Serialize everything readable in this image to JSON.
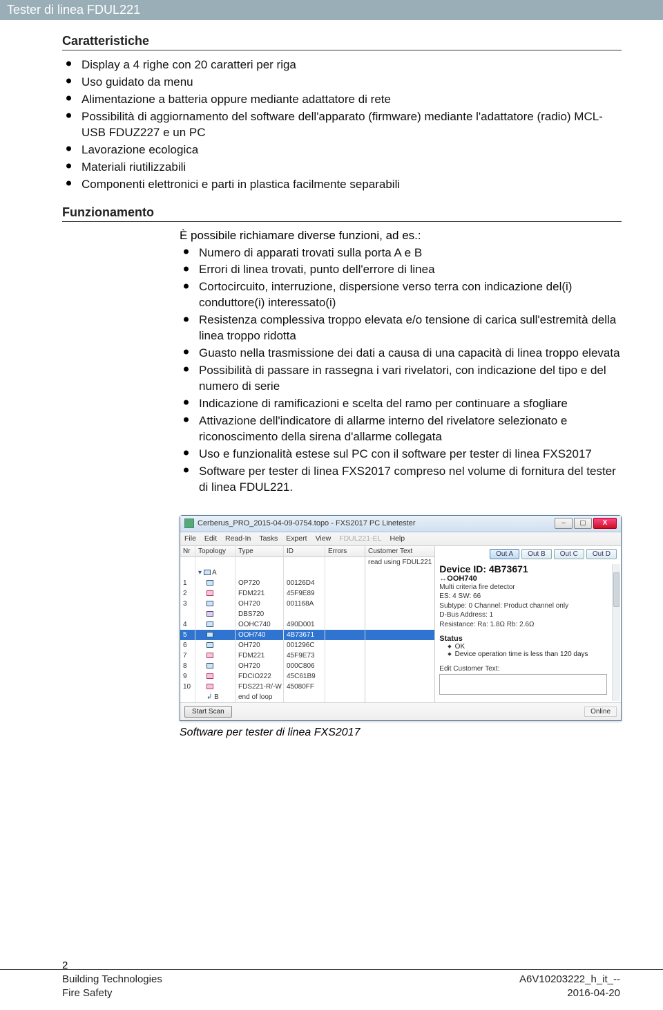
{
  "title_bar": "Tester di linea FDUL221",
  "sections": {
    "caratteristiche": {
      "heading": "Caratteristiche",
      "items": [
        "Display a 4 righe con 20 caratteri per riga",
        "Uso guidato da menu",
        "Alimentazione a batteria oppure mediante adattatore di rete",
        "Possibilità di aggiornamento del software dell'apparato (firmware) mediante l'adattatore (radio) MCL-USB FDUZ227 e un PC",
        "Lavorazione ecologica",
        "Materiali riutilizzabili",
        "Componenti elettronici e parti in plastica facilmente separabili"
      ]
    },
    "funzionamento": {
      "heading": "Funzionamento",
      "intro": "È possibile richiamare diverse funzioni, ad es.:",
      "items": [
        "Numero di apparati trovati sulla porta A e B",
        "Errori di linea trovati, punto dell'errore di linea",
        "Cortocircuito, interruzione, dispersione verso terra con indicazione del(i) conduttore(i) interessato(i)",
        "Resistenza complessiva troppo elevata e/o tensione di carica sull'estremità della linea troppo ridotta",
        "Guasto nella trasmissione dei dati a causa di una capacità di linea troppo elevata",
        "Possibilità di passare in rassegna i vari rivelatori, con indicazione del tipo e del numero di serie",
        "Indicazione di ramificazioni e scelta del ramo per continuare a sfogliare",
        "Attivazione dell'indicatore di allarme interno del rivelatore selezionato e riconoscimento della sirena d'allarme collegata",
        "Uso e funzionalità estese sul PC con il software per tester di linea FXS2017",
        "Software per tester di linea FXS2017 compreso nel volume di fornitura del tester di linea FDUL221."
      ]
    }
  },
  "screenshot": {
    "window_title": "Cerberus_PRO_2015-04-09-0754.topo - FXS2017 PC Linetester",
    "menus": [
      "File",
      "Edit",
      "Read-In",
      "Tasks",
      "Expert",
      "View",
      "FDUL221-EL",
      "Help"
    ],
    "menu_dim_index": 6,
    "columns": {
      "nr": "Nr",
      "topo": "Topology",
      "type": "Type",
      "id": "ID",
      "err": "Errors",
      "cust": "Customer Text"
    },
    "cust_header_note": "read using FDUL221",
    "rows": [
      {
        "nr": "",
        "topo_label": "▾ ▢ A",
        "type": "",
        "id": "",
        "sel": false,
        "style": "root"
      },
      {
        "nr": "1",
        "type": "OP720",
        "id": "00126D4",
        "sel": false,
        "style": "blue"
      },
      {
        "nr": "2",
        "type": "FDM221",
        "id": "45F9E89",
        "sel": false,
        "style": "pink"
      },
      {
        "nr": "3",
        "type": "OH720",
        "id": "001168A",
        "sel": false,
        "style": "blue"
      },
      {
        "nr": "",
        "type": "DBS720",
        "id": "",
        "sel": false,
        "style": "purple"
      },
      {
        "nr": "4",
        "type": "OOHC740",
        "id": "490D001",
        "sel": false,
        "style": "blue"
      },
      {
        "nr": "5",
        "type": "OOH740",
        "id": "4B73671",
        "sel": true,
        "style": "blue"
      },
      {
        "nr": "6",
        "type": "OH720",
        "id": "001296C",
        "sel": false,
        "style": "blue"
      },
      {
        "nr": "7",
        "type": "FDM221",
        "id": "45F9E73",
        "sel": false,
        "style": "pink"
      },
      {
        "nr": "8",
        "type": "OH720",
        "id": "000C806",
        "sel": false,
        "style": "blue"
      },
      {
        "nr": "9",
        "type": "FDCIO222",
        "id": "45C61B9",
        "sel": false,
        "style": "pink"
      },
      {
        "nr": "10",
        "type": "FDS221-R/-W",
        "id": "45080FF",
        "sel": false,
        "style": "pink"
      },
      {
        "nr": "",
        "type": "end of loop",
        "id": "",
        "sel": false,
        "style": "end",
        "topo_label": "↲ B"
      }
    ],
    "out_tabs": [
      "Out A",
      "Out B",
      "Out C",
      "Out D"
    ],
    "detail": {
      "device_id_label": "Device ID: 4B73671",
      "model": "OOH740",
      "desc": "Multi criteria fire detector",
      "es_sw": "ES: 4   SW: 66",
      "subtype": "Subtype: 0  Channel: Product channel only",
      "dbus": "D-Bus Address: 1",
      "resist": "Resistance: Ra: 1.8Ω Rb: 2.6Ω",
      "status_h": "Status",
      "status_items": [
        "OK",
        "Device operation time is less than 120 days"
      ],
      "edit_label": "Edit Customer Text:"
    },
    "start_scan": "Start Scan",
    "status_online": "Online"
  },
  "caption": "Software per tester di linea FXS2017",
  "footer": {
    "page_num": "2",
    "left1": "Building Technologies",
    "left2": "Fire Safety",
    "right1": "A6V10203222_h_it_--",
    "right2": "2016-04-20"
  }
}
